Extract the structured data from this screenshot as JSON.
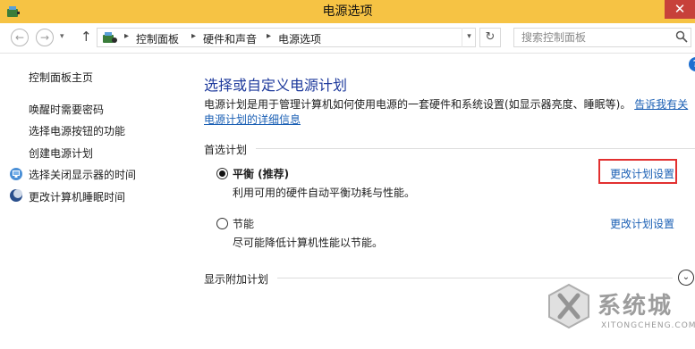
{
  "window": {
    "title": "电源选项",
    "close_glyph": "✕"
  },
  "nav": {
    "back_glyph": "←",
    "forward_glyph": "→",
    "history_glyph": "▾",
    "up_glyph": "↑",
    "breadcrumbs": [
      "控制面板",
      "硬件和声音",
      "电源选项"
    ],
    "crumb_sep": "▸",
    "dropdown_glyph": "▾",
    "refresh_glyph": "↻",
    "search_placeholder": "搜索控制面板"
  },
  "sidebar": {
    "home": "控制面板主页",
    "items": [
      {
        "label": "唤醒时需要密码",
        "icon": ""
      },
      {
        "label": "选择电源按钮的功能",
        "icon": ""
      },
      {
        "label": "创建电源计划",
        "icon": ""
      },
      {
        "label": "选择关闭显示器的时间",
        "icon": "monitor-icon"
      },
      {
        "label": "更改计算机睡眠时间",
        "icon": "moon-icon"
      }
    ]
  },
  "main": {
    "title": "选择或自定义电源计划",
    "description": "电源计划是用于管理计算机如何使用电源的一套硬件和系统设置(如显示器亮度、睡眠等)。",
    "description_link": "告诉我有关电源计划的详细信息",
    "help_glyph": "?",
    "preferred_label": "首选计划",
    "plans": [
      {
        "name": "平衡 (推荐)",
        "description": "利用可用的硬件自动平衡功耗与性能。",
        "link": "更改计划设置",
        "selected": true
      },
      {
        "name": "节能",
        "description": "尽可能降低计算机性能以节能。",
        "link": "更改计划设置",
        "selected": false
      }
    ],
    "additional_label": "显示附加计划",
    "expand_glyph": "⌄"
  },
  "watermark": {
    "text": "系统城",
    "url": "XITONGCHENG.COM"
  },
  "colors": {
    "titlebar": "#f6c344",
    "close": "#c7413a",
    "link": "#1a5fb4",
    "title": "#1e3a9c",
    "highlight": "#e23030"
  }
}
